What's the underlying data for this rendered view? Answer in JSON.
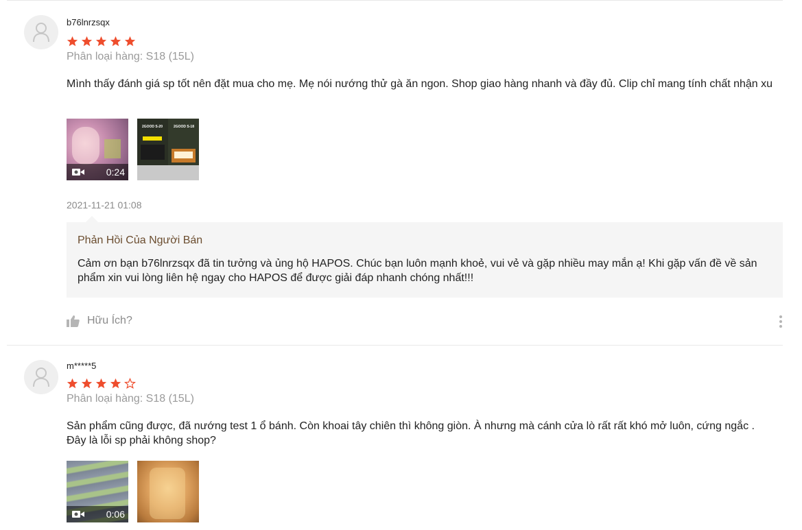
{
  "colors": {
    "star": "#ee4d2d",
    "seller_title": "#6b4d2f",
    "muted": "#8a8a8a"
  },
  "reviews": [
    {
      "username": "b76lnrzsqx",
      "rating": 5,
      "variation": "Phân loại hàng: S18 (15L)",
      "comment": "Mình thấy đánh giá sp tốt nên đặt mua cho mẹ. Mẹ nói nướng thử gà ăn ngon. Shop giao hàng nhanh và đầy đủ. Clip chỉ mang tính chất nhận xu",
      "video_duration": "0:24",
      "product_image_labels": [
        "2GOOD S-20",
        "2GOOD S-18"
      ],
      "timestamp": "2021-11-21 01:08",
      "seller_reply": {
        "title": "Phản Hồi Của Người Bán",
        "text": "Cảm ơn bạn b76lnrzsqx đã tin tưởng và ủng hộ HAPOS. Chúc bạn luôn mạnh khoẻ, vui vẻ và gặp nhiều may mắn ạ! Khi gặp vấn đề về sản phẩm xin vui lòng liên hệ ngay cho HAPOS để được giải đáp nhanh chóng nhất!!!"
      },
      "helpful_label": "Hữu Ích?"
    },
    {
      "username": "m*****5",
      "rating": 4,
      "variation": "Phân loại hàng: S18 (15L)",
      "comment": "Sản phẩm cũng được, đã nướng test 1 ổ bánh. Còn khoai tây chiên thì không giòn. À nhưng mà cánh cửa lò rất rất khó mở luôn, cứng ngắc . Đây là lỗi sp phải không shop?",
      "video_duration": "0:06"
    }
  ]
}
